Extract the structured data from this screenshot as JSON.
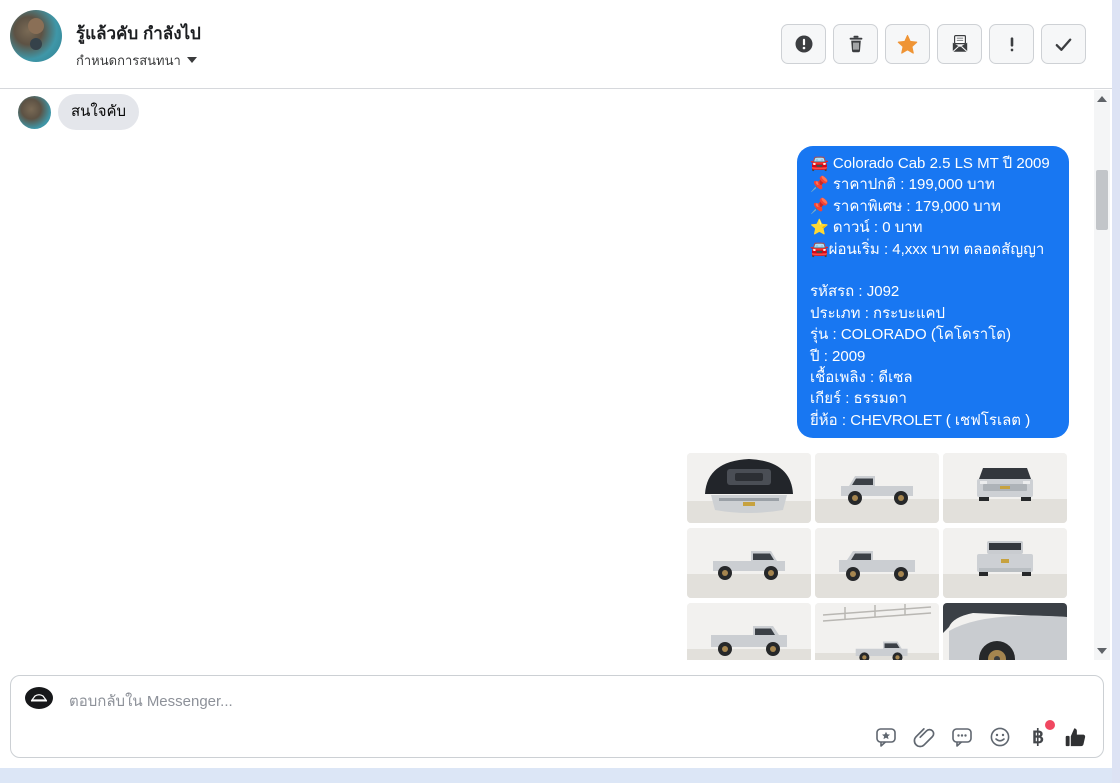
{
  "header": {
    "title": "รู้แล้วคับ กำลังไป",
    "subtitle": "กำหนดการสนทนา",
    "toolbar": [
      {
        "icon": "exclamation-circle-icon"
      },
      {
        "icon": "trash-icon"
      },
      {
        "icon": "star-icon",
        "color": "#ef9435"
      },
      {
        "icon": "envelope-unread-icon"
      },
      {
        "icon": "exclamation-icon"
      },
      {
        "icon": "check-icon"
      }
    ]
  },
  "conversation": {
    "incoming": {
      "text": "สนใจคับ"
    },
    "outgoing": {
      "bubble_color": "#1877f2",
      "lines": [
        "🚘 Colorado Cab 2.5 LS MT ปี 2009",
        "📌 ราคาปกติ : 199,000 บาท",
        "📌 ราคาพิเศษ : 179,000 บาท",
        "⭐ ดาวน์ : 0 บาท",
        "🚘ผ่อนเริ่ม : 4,xxx บาท ตลอดสัญญา",
        "",
        "รหัสรถ : J092",
        "ประเภท : กระบะแคป",
        "รุ่น : COLORADO (โคโดราโด)",
        "ปี : 2009",
        "เชื้อเพลิง : ดีเซล",
        "เกียร์ : ธรรมดา",
        "ยี่ห้อ : CHEVROLET ( เชฟโรเลต )"
      ]
    },
    "gallery": {
      "photos": [
        {
          "label": "engine-bay"
        },
        {
          "label": "front-three-quarter-left"
        },
        {
          "label": "front-view"
        },
        {
          "label": "front-three-quarter-right"
        },
        {
          "label": "rear-three-quarter"
        },
        {
          "label": "rear-view"
        },
        {
          "label": "rear-three-quarter-left"
        },
        {
          "label": "side-profile"
        },
        {
          "label": "front-fender-closeup"
        }
      ]
    }
  },
  "composer": {
    "placeholder": "ตอบกลับใน Messenger...",
    "icons": [
      "saved-replies-icon",
      "paperclip-icon",
      "comment-ellipsis-icon",
      "emoji-icon",
      "baht-payment-icon",
      "thumbs-up-icon"
    ],
    "badge_color": "#f04760"
  }
}
